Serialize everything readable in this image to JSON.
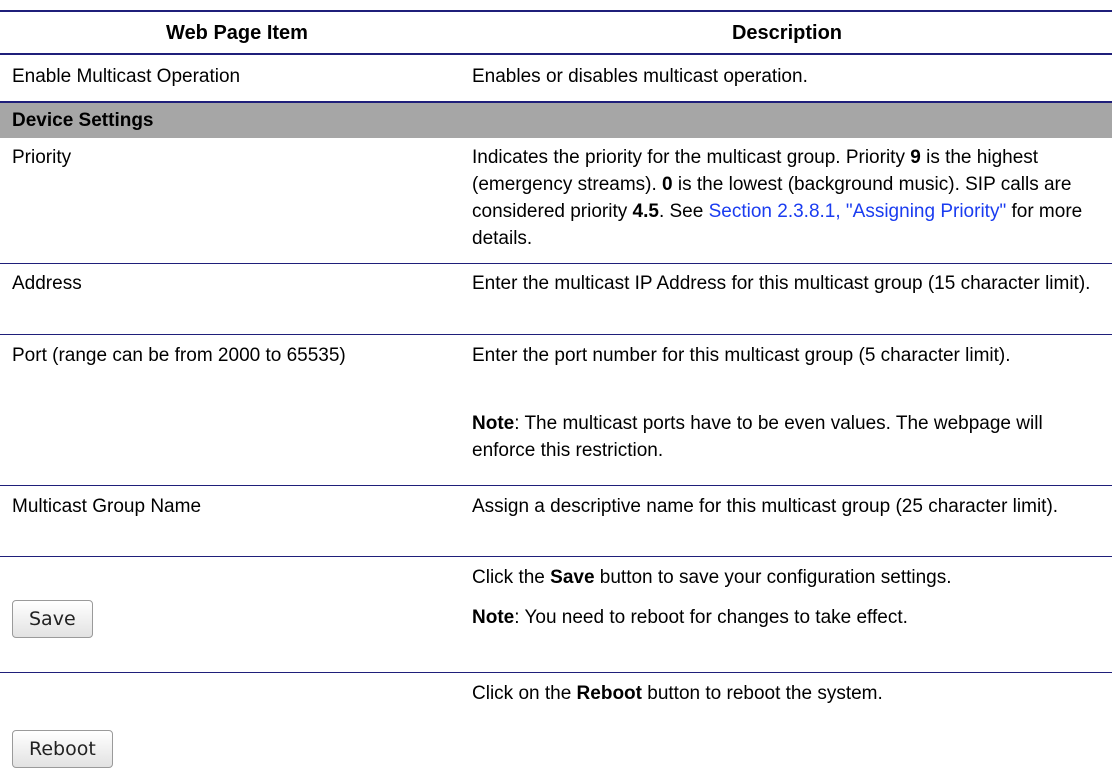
{
  "header": {
    "col1": "Web Page Item",
    "col2": "Description"
  },
  "rows": {
    "enable": {
      "item": "Enable Multicast Operation",
      "desc": "Enables or disables multicast operation."
    },
    "section": "Device Settings",
    "priority": {
      "item": "Priority",
      "desc_a": "Indicates the priority for the multicast group. Priority ",
      "b1": "9",
      "desc_b": " is the highest (emergency streams). ",
      "b2": "0",
      "desc_c": " is the lowest (background music). SIP calls are considered priority ",
      "b3": "4.5",
      "desc_d": ". See ",
      "link": "Section 2.3.8.1, \"Assigning Priority\"",
      "desc_e": " for more details."
    },
    "address": {
      "item": "Address",
      "desc": "Enter the multicast IP Address for this multicast group (15 character limit)."
    },
    "port": {
      "item": "Port (range can be from 2000 to 65535)",
      "desc": "Enter the port number for this multicast group (5 character limit).",
      "note_label": "Note",
      "note": ": The multicast ports have to be even values. The webpage will enforce this restriction."
    },
    "group_name": {
      "item": "Multicast Group Name",
      "desc": "Assign a descriptive name for this multicast group (25 character limit)."
    },
    "save": {
      "button": "Save",
      "desc_a": "Click the ",
      "bold": "Save",
      "desc_b": " button to save your configuration settings.",
      "note_label": "Note",
      "note": ": You need to reboot for changes to take effect."
    },
    "reboot": {
      "button": "Reboot",
      "desc_a": "Click on the ",
      "bold": "Reboot",
      "desc_b": " button to reboot the system."
    }
  }
}
